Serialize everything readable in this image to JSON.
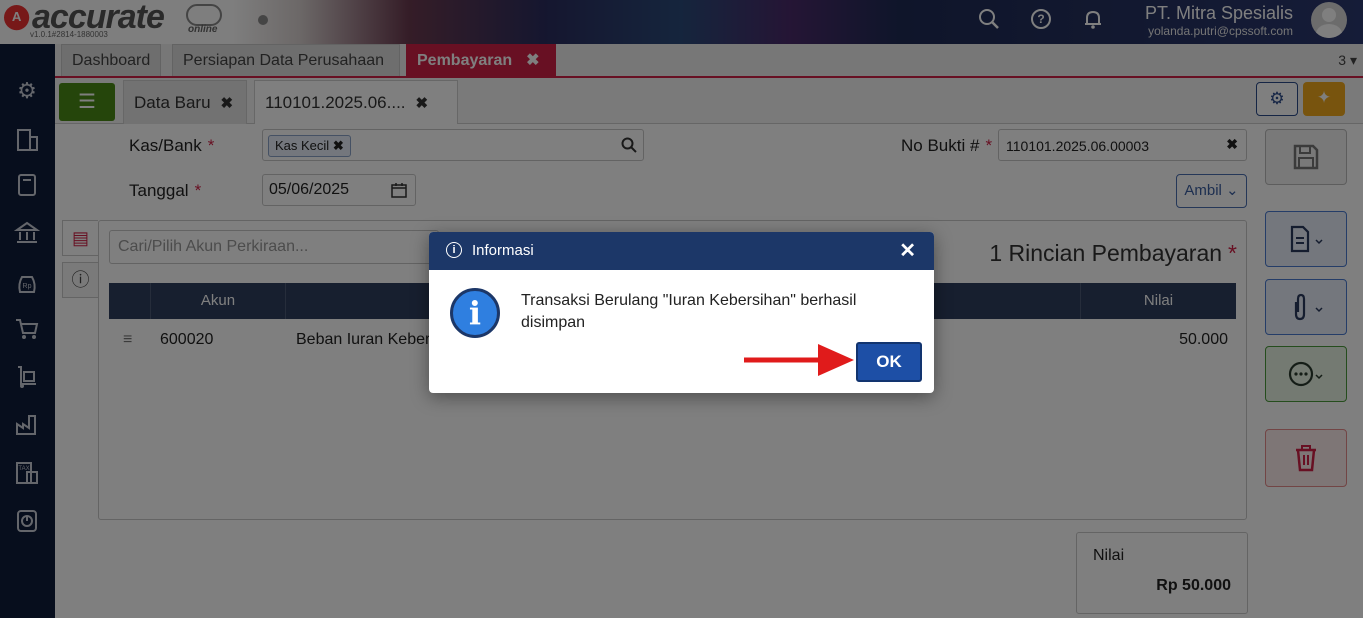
{
  "header": {
    "logo_letter": "A",
    "logo_text": "accurate",
    "logo_sub": "online",
    "version": "v1.0.1#2814-1880003",
    "company": "PT. Mitra Spesialis",
    "email": "yolanda.putri@cpssoft.com",
    "icons": [
      "search-icon",
      "help-icon",
      "bell-icon"
    ]
  },
  "sidebar": {
    "icons": [
      "gear-icon",
      "building-icon",
      "book-icon",
      "bank-icon",
      "money-bag-icon",
      "cart-icon",
      "dolly-icon",
      "factory-icon",
      "tax-icon",
      "report-icon"
    ]
  },
  "module_tabs": {
    "items": [
      {
        "label": "Dashboard"
      },
      {
        "label": "Persiapan Data Perusahaan"
      },
      {
        "label": "Pembayaran",
        "active": true
      }
    ],
    "close_glyph": "✖",
    "count": "3"
  },
  "form_tabs": {
    "items": [
      {
        "label": "Data Baru"
      },
      {
        "label": "110101.2025.06....",
        "active": true
      }
    ],
    "close_glyph": "✖"
  },
  "form": {
    "kas_bank_label": "Kas/Bank",
    "kas_bank_value": "Kas Kecil",
    "tanggal_label": "Tanggal",
    "tanggal_value": "05/06/2025",
    "no_bukti_label": "No Bukti #",
    "no_bukti_value": "110101.2025.06.00003",
    "required_mark": "*",
    "ambil_label": "Ambil"
  },
  "detail": {
    "search_placeholder": "Cari/Pilih Akun Perkiraan...",
    "title": "1 Rincian Pembayaran",
    "columns": [
      "Akun",
      "Nilai"
    ],
    "rows": [
      {
        "akun": "600020",
        "nama": "Beban Iuran Keber",
        "nilai": "50.000"
      }
    ]
  },
  "summary": {
    "label": "Nilai",
    "value": "Rp 50.000"
  },
  "modal": {
    "title": "Informasi",
    "message": "Transaksi Berulang \"Iuran Kebersihan\" berhasil disimpan",
    "ok_label": "OK"
  },
  "colors": {
    "accent": "#d02146",
    "navy": "#1c3768",
    "sidebar": "#0f1c3a",
    "arrow": "#e01b1b"
  }
}
